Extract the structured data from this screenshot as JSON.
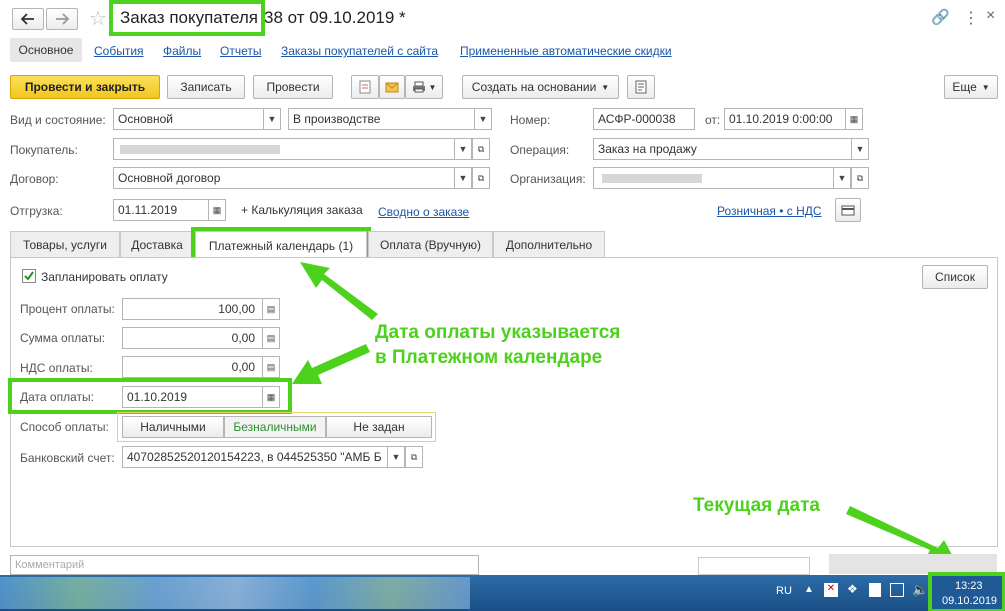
{
  "window": {
    "title": "Заказ покупателя",
    "title_rest": "38 от 09.10.2019 *"
  },
  "nav": {
    "main": "Основное",
    "links": [
      "События",
      "Файлы",
      "Отчеты",
      "Заказы покупателей с сайта",
      "Примененные автоматические скидки"
    ]
  },
  "toolbar": {
    "post_close": "Провести и закрыть",
    "save": "Записать",
    "post": "Провести",
    "create_based": "Создать на основании",
    "more": "Еще"
  },
  "header_form": {
    "state_label": "Вид и состояние:",
    "state_value": "Основной",
    "status_value": "В производстве",
    "number_label": "Номер:",
    "number_value": "АСФР-000038",
    "date_label": "от:",
    "date_value": "01.10.2019  0:00:00",
    "buyer_label": "Покупатель:",
    "operation_label": "Операция:",
    "operation_value": "Заказ на продажу",
    "contract_label": "Договор:",
    "contract_value": "Основной договор",
    "org_label": "Организация:",
    "shipment_label": "Отгрузка:",
    "shipment_value": "01.11.2019",
    "calc_label": "+ Калькуляция заказа",
    "summary_link": "Сводно о заказе",
    "retail_link": "Розничная • с НДС"
  },
  "tabs": [
    "Товары, услуги",
    "Доставка",
    "Платежный календарь (1)",
    "Оплата (Вручную)",
    "Дополнительно"
  ],
  "payment": {
    "plan_label": "Запланировать оплату",
    "list_button": "Список",
    "percent_label": "Процент оплаты:",
    "percent_value": "100,00",
    "sum_label": "Сумма оплаты:",
    "sum_value": "0,00",
    "vat_label": "НДС оплаты:",
    "vat_value": "0,00",
    "date_label": "Дата оплаты:",
    "date_value": "01.10.2019",
    "method_label": "Способ оплаты:",
    "methods": [
      "Наличными",
      "Безналичными",
      "Не задан"
    ],
    "bank_label": "Банковский счет:",
    "bank_value": "40702852520120154223, в 044525350 \"АМБ Б"
  },
  "annotations": {
    "payment_date_line1": "Дата оплаты указывается",
    "payment_date_line2": "в Платежном календаре",
    "current_date": "Текущая дата"
  },
  "bottom": {
    "comment_placeholder": "Комментарий"
  },
  "taskbar": {
    "lang": "RU",
    "time": "13:23",
    "date": "09.10.2019"
  },
  "colors": {
    "accent_yellow": "#f7d231",
    "highlight_green": "#4cd11c",
    "link_blue": "#1b56a8",
    "taskbar_blue": "#1f5a96"
  }
}
